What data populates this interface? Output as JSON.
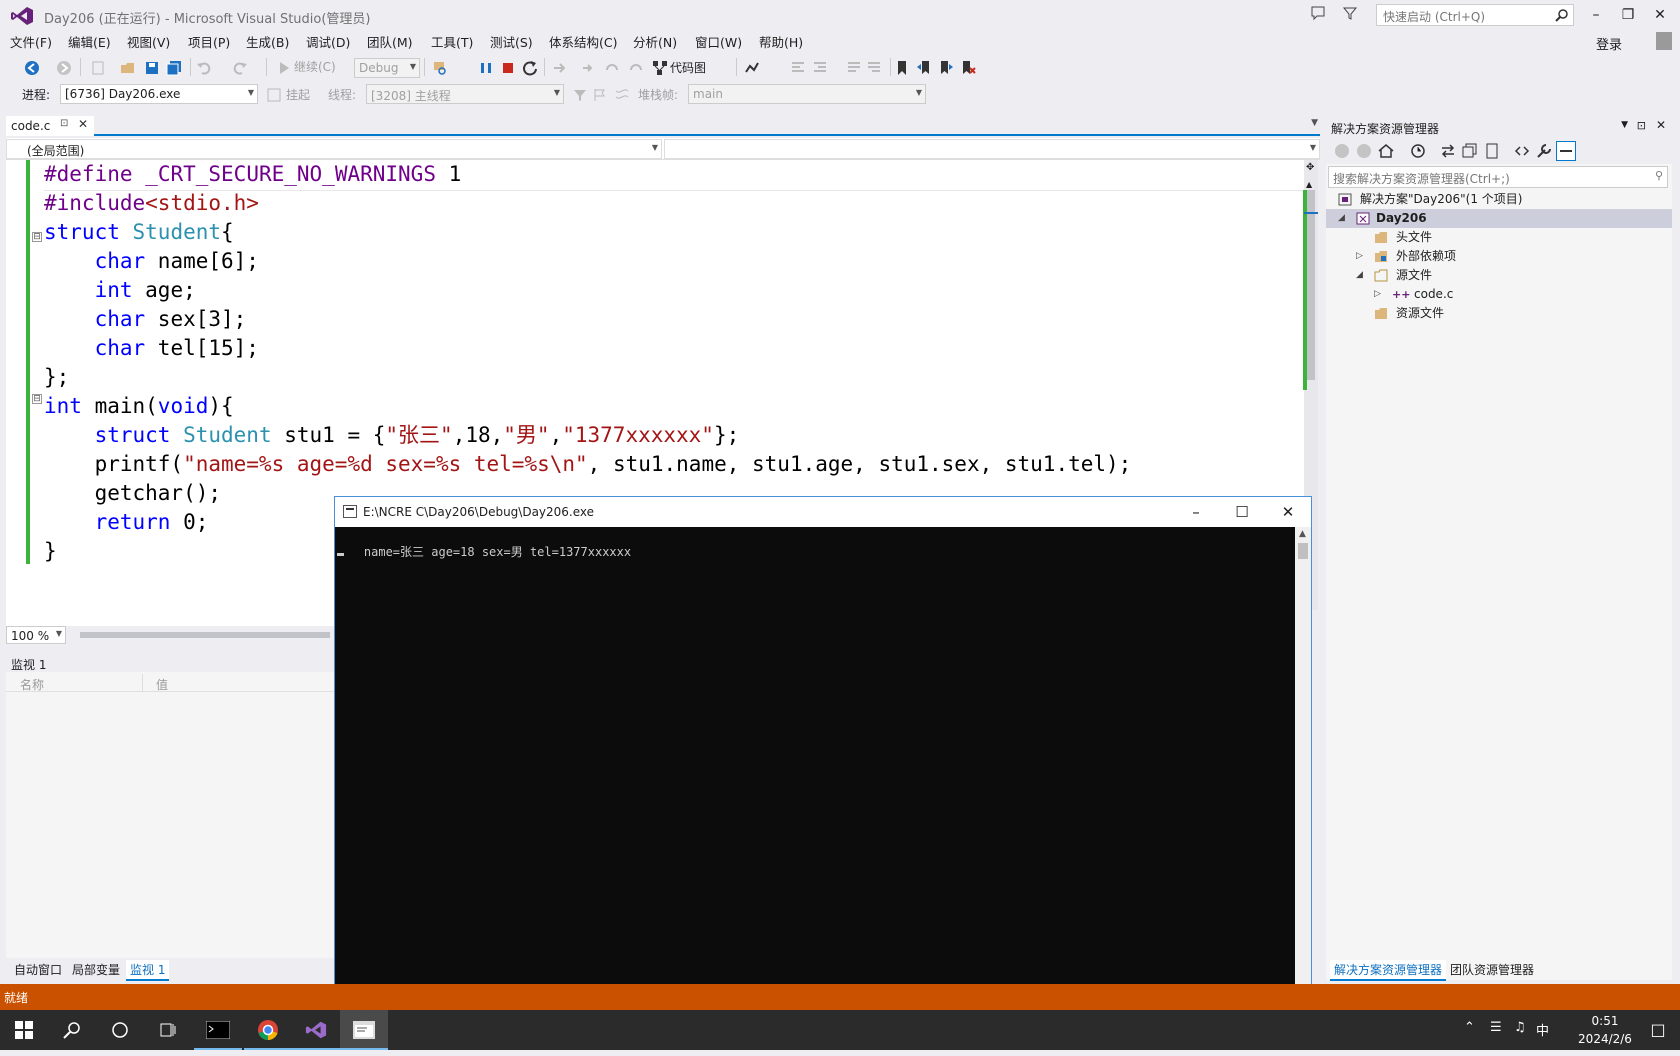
{
  "window": {
    "title": "Day206 (正在运行) - Microsoft Visual Studio(管理员)",
    "quick_launch_placeholder": "快速启动 (Ctrl+Q)",
    "login": "登录"
  },
  "menu": [
    "文件(F)",
    "编辑(E)",
    "视图(V)",
    "项目(P)",
    "生成(B)",
    "调试(D)",
    "团队(M)",
    "工具(T)",
    "测试(S)",
    "体系结构(C)",
    "分析(N)",
    "窗口(W)",
    "帮助(H)"
  ],
  "toolbar": {
    "config": "Debug",
    "continue_label": "继续(C)",
    "code_map_label": "代码图",
    "process_label": "进程:",
    "process_value": "[6736] Day206.exe",
    "suspend_label": "挂起",
    "thread_label": "线程:",
    "thread_value": "[3208] 主线程",
    "stackframe_label": "堆栈帧:",
    "stackframe_value": "main"
  },
  "editor": {
    "tab_name": "code.c",
    "scope": "(全局范围)",
    "zoom": "100 %",
    "lines": [
      {
        "parts": [
          {
            "c": "mc",
            "t": "#define"
          },
          {
            "c": "",
            "t": " "
          },
          {
            "c": "mc",
            "t": "_CRT_SECURE_NO_WARNINGS"
          },
          {
            "c": "",
            "t": " 1"
          }
        ]
      },
      {
        "parts": [
          {
            "c": "mc",
            "t": "#include"
          },
          {
            "c": "st",
            "t": "<stdio.h>"
          }
        ]
      },
      {
        "parts": [
          {
            "c": "kw",
            "t": "struct"
          },
          {
            "c": "",
            "t": " "
          },
          {
            "c": "ty",
            "t": "Student"
          },
          {
            "c": "",
            "t": "{"
          }
        ]
      },
      {
        "parts": [
          {
            "c": "",
            "t": "    "
          },
          {
            "c": "kw",
            "t": "char"
          },
          {
            "c": "",
            "t": " name[6];"
          }
        ]
      },
      {
        "parts": [
          {
            "c": "",
            "t": "    "
          },
          {
            "c": "kw",
            "t": "int"
          },
          {
            "c": "",
            "t": " age;"
          }
        ]
      },
      {
        "parts": [
          {
            "c": "",
            "t": "    "
          },
          {
            "c": "kw",
            "t": "char"
          },
          {
            "c": "",
            "t": " sex[3];"
          }
        ]
      },
      {
        "parts": [
          {
            "c": "",
            "t": "    "
          },
          {
            "c": "kw",
            "t": "char"
          },
          {
            "c": "",
            "t": " tel[15];"
          }
        ]
      },
      {
        "parts": [
          {
            "c": "",
            "t": "};"
          }
        ]
      },
      {
        "parts": [
          {
            "c": "kw",
            "t": "int"
          },
          {
            "c": "",
            "t": " main("
          },
          {
            "c": "kw",
            "t": "void"
          },
          {
            "c": "",
            "t": "){"
          }
        ]
      },
      {
        "parts": [
          {
            "c": "",
            "t": "    "
          },
          {
            "c": "kw",
            "t": "struct"
          },
          {
            "c": "",
            "t": " "
          },
          {
            "c": "ty",
            "t": "Student"
          },
          {
            "c": "",
            "t": " stu1 = {"
          },
          {
            "c": "st",
            "t": "\"张三\""
          },
          {
            "c": "",
            "t": ",18,"
          },
          {
            "c": "st",
            "t": "\"男\""
          },
          {
            "c": "",
            "t": ","
          },
          {
            "c": "st",
            "t": "\"1377xxxxxx\""
          },
          {
            "c": "",
            "t": "};"
          }
        ]
      },
      {
        "parts": [
          {
            "c": "",
            "t": "    printf("
          },
          {
            "c": "st",
            "t": "\"name=%s age=%d sex=%s tel=%s\\n\""
          },
          {
            "c": "",
            "t": ", stu1.name, stu1.age, stu1.sex, stu1.tel);"
          }
        ]
      },
      {
        "parts": [
          {
            "c": "",
            "t": "    getchar();"
          }
        ]
      },
      {
        "parts": [
          {
            "c": "",
            "t": "    "
          },
          {
            "c": "kw",
            "t": "return"
          },
          {
            "c": "",
            "t": " 0;"
          }
        ]
      },
      {
        "parts": [
          {
            "c": "",
            "t": "}"
          }
        ]
      }
    ]
  },
  "watch": {
    "title": "监视 1",
    "col_name": "名称",
    "col_value": "值",
    "tabs": [
      "自动窗口",
      "局部变量",
      "监视 1"
    ]
  },
  "solution_explorer": {
    "title": "解决方案资源管理器",
    "search_placeholder": "搜索解决方案资源管理器(Ctrl+;)",
    "solution": "解决方案\"Day206\"(1 个项目)",
    "project": "Day206",
    "items": [
      "头文件",
      "外部依赖项",
      "源文件",
      "code.c",
      "资源文件"
    ],
    "tabs": [
      "解决方案资源管理器",
      "团队资源管理器"
    ]
  },
  "console": {
    "title": "E:\\NCRE C\\Day206\\Debug\\Day206.exe",
    "output": "name=张三 age=18 sex=男 tel=1377xxxxxx"
  },
  "status": "就绪",
  "taskbar": {
    "ime": "中",
    "time": "0:51",
    "date": "2024/2/6"
  },
  "colors": {
    "accent": "#007acc",
    "status_debug": "#ca5100",
    "keyword": "#0000ff",
    "type": "#2b91af",
    "string": "#a31515",
    "macro": "#6f008a"
  }
}
